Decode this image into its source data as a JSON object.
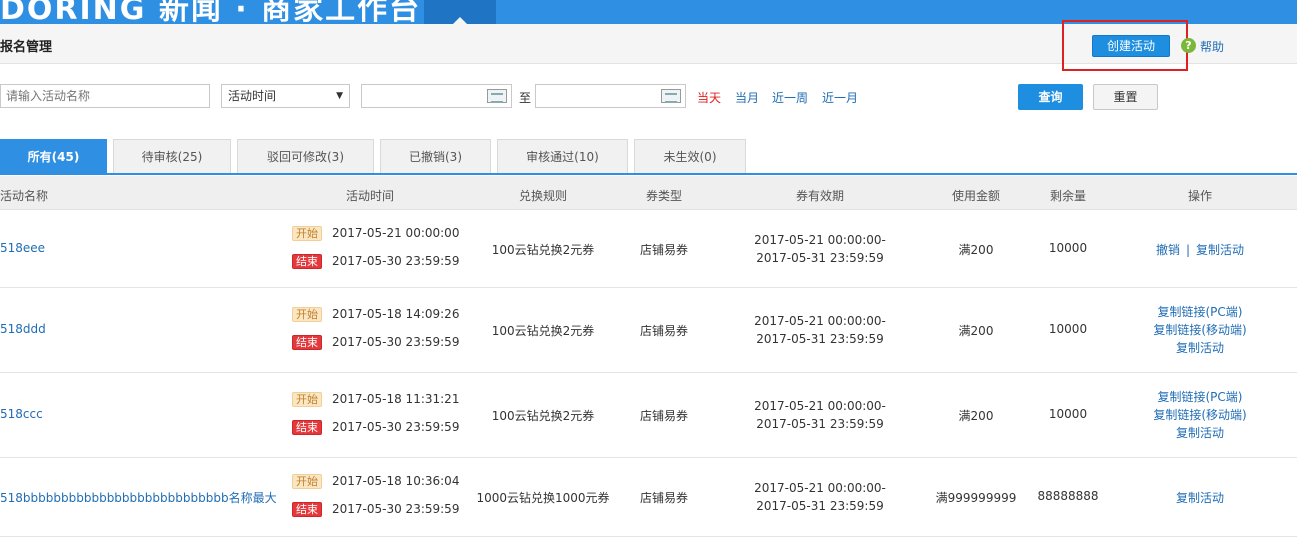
{
  "topbar": {
    "brand": "DORING 新闻 · 商家工作台"
  },
  "header": {
    "title": "报名管理",
    "create_label": "创建活动",
    "help_icon": "question-icon",
    "help_label": "帮助",
    "help_glyph": "?"
  },
  "filters": {
    "search_placeholder": "请输入活动名称",
    "time_select": "活动时间",
    "to_label": "至",
    "quick": [
      "当天",
      "当月",
      "近一周",
      "近一月"
    ],
    "query_label": "查询",
    "reset_label": "重置"
  },
  "tabs": [
    "所有(45)",
    "待审核(25)",
    "驳回可修改(3)",
    "已撤销(3)",
    "审核通过(10)",
    "未生效(0)"
  ],
  "columns": [
    "活动名称",
    "活动时间",
    "兑换规则",
    "券类型",
    "券有效期",
    "使用金额",
    "剩余量",
    "操作"
  ],
  "time_tags": {
    "start": "开始",
    "end": "结束"
  },
  "rows": [
    {
      "name": "518eee",
      "start": "2017-05-21 00:00:00",
      "end": "2017-05-30 23:59:59",
      "rule": "100云钻兑换2元券",
      "type": "店铺易券",
      "valid_from": "2017-05-21 00:00:00-",
      "valid_to": "2017-05-31 23:59:59",
      "amount": "满200",
      "remain": "10000",
      "ops": [
        "撤销",
        "|",
        "复制活动"
      ]
    },
    {
      "name": "518ddd",
      "start": "2017-05-18 14:09:26",
      "end": "2017-05-30 23:59:59",
      "rule": "100云钻兑换2元券",
      "type": "店铺易券",
      "valid_from": "2017-05-21 00:00:00-",
      "valid_to": "2017-05-31 23:59:59",
      "amount": "满200",
      "remain": "10000",
      "ops": [
        "复制链接(PC端)",
        "复制链接(移动端)",
        "复制活动"
      ]
    },
    {
      "name": "518ccc",
      "start": "2017-05-18 11:31:21",
      "end": "2017-05-30 23:59:59",
      "rule": "100云钻兑换2元券",
      "type": "店铺易券",
      "valid_from": "2017-05-21 00:00:00-",
      "valid_to": "2017-05-31 23:59:59",
      "amount": "满200",
      "remain": "10000",
      "ops": [
        "复制链接(PC端)",
        "复制链接(移动端)",
        "复制活动"
      ]
    },
    {
      "name": "518bbbbbbbbbbbbbbbbbbbbbbbbbbb名称最大",
      "start": "2017-05-18 10:36:04",
      "end": "2017-05-30 23:59:59",
      "rule": "1000云钻兑换1000元券",
      "type": "店铺易券",
      "valid_from": "2017-05-21 00:00:00-",
      "valid_to": "2017-05-31 23:59:59",
      "amount": "满999999999",
      "remain": "88888888",
      "ops": [
        "复制活动"
      ]
    }
  ]
}
